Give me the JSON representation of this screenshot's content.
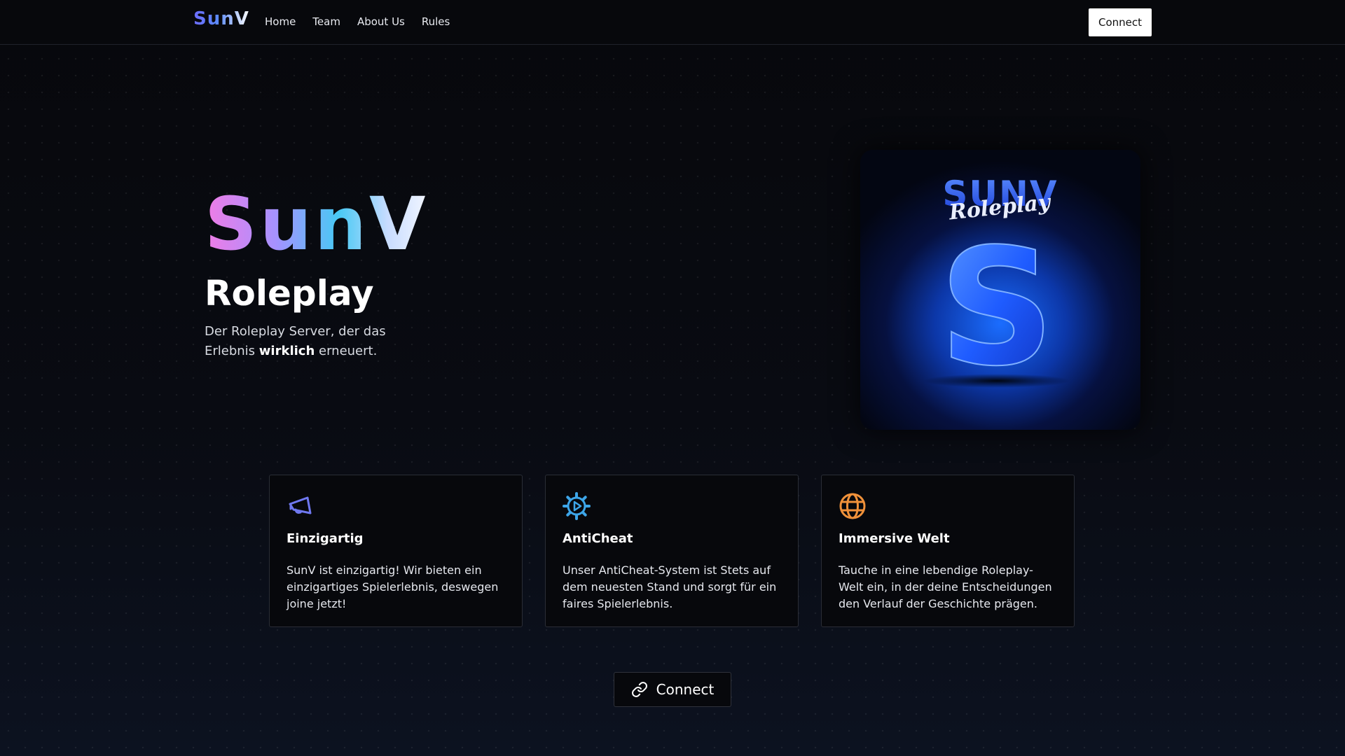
{
  "nav": {
    "brand": "SunV",
    "links": [
      {
        "label": "Home"
      },
      {
        "label": "Team"
      },
      {
        "label": "About Us"
      },
      {
        "label": "Rules"
      }
    ],
    "connect_label": "Connect"
  },
  "hero": {
    "title": "SunV",
    "subtitle": "Roleplay",
    "tagline_before": "Der Roleplay Server, der das Erlebnis ",
    "tagline_bold": "wirklich",
    "tagline_after": " erneuert.",
    "logo": {
      "wordmark": "SUNV",
      "script": "Roleplay",
      "monogram": "S"
    }
  },
  "features": [
    {
      "icon": "megaphone-icon",
      "icon_color": "#6f78f0",
      "title": "Einzigartig",
      "text": "SunV ist einzigartig! Wir bieten ein einzigartiges Spielerlebnis, deswegen joine jetzt!"
    },
    {
      "icon": "gear-play-icon",
      "icon_color": "#3da5e8",
      "title": "AntiCheat",
      "text": "Unser AntiCheat-System ist Stets auf dem neuesten Stand und sorgt für ein faires Spielerlebnis."
    },
    {
      "icon": "globe-icon",
      "icon_color": "#f0913a",
      "title": "Immersive Welt",
      "text": "Tauche in eine lebendige Roleplay-Welt ein, in der deine Entscheidungen den Verlauf der Geschichte prägen."
    }
  ],
  "cta": {
    "icon": "link-icon",
    "label": "Connect"
  },
  "colors": {
    "background": "#08090e",
    "card_border": "#2a2d36",
    "accent_blue": "#1b6dff"
  }
}
